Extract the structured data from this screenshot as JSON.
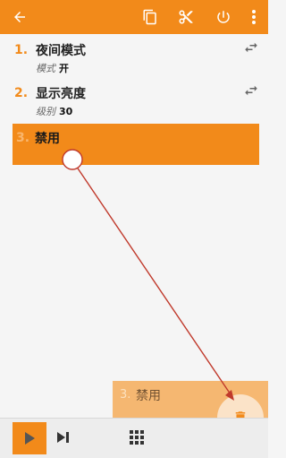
{
  "list": {
    "items": [
      {
        "num": "1.",
        "title": "夜间模式",
        "sub_key": "模式",
        "sub_val": "开"
      },
      {
        "num": "2.",
        "title": "显示亮度",
        "sub_key": "级别",
        "sub_val": "30"
      }
    ],
    "dragging": {
      "num": "3.",
      "title": "禁用"
    },
    "ghost": {
      "num": "3.",
      "title": "禁用"
    }
  },
  "colors": {
    "accent": "#f28a1a",
    "arrow": "#c0392b"
  },
  "icons": {
    "back": "arrow-left-icon",
    "copy": "copy-icon",
    "cut": "scissors-icon",
    "power": "power-icon",
    "more": "more-vertical-icon",
    "swap": "swap-icon",
    "trash": "trash-icon",
    "play": "play-icon",
    "step": "skip-next-icon",
    "grid": "grid-icon"
  }
}
